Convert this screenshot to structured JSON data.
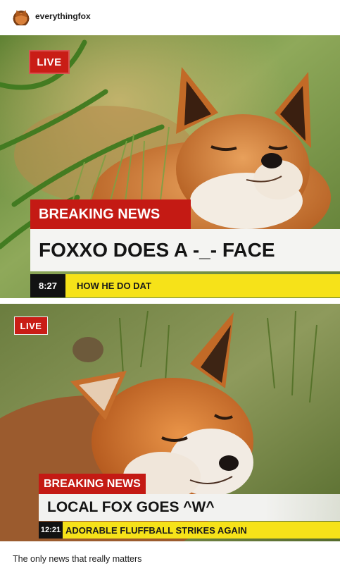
{
  "post": {
    "username": "everythingfox",
    "avatar_icon": "fox-avatar-icon",
    "caption": "The only news that really matters"
  },
  "panels": [
    {
      "live": "LIVE",
      "breaking": "BREAKING NEWS",
      "headline": "FOXXO DOES A -_- FACE",
      "time": "8:27",
      "ticker": "HOW HE DO DAT"
    },
    {
      "live": "LIVE",
      "breaking": "BREAKING NEWS",
      "headline": "LOCAL FOX GOES ^W^",
      "time": "12:21",
      "ticker": "ADORABLE FLUFFBALL STRIKES AGAIN"
    }
  ],
  "colors": {
    "breaking_red": "#c41a14",
    "ticker_yellow": "#f6e219",
    "headline_bg": "#f4f4f2",
    "fox_orange": "#d8782d"
  }
}
